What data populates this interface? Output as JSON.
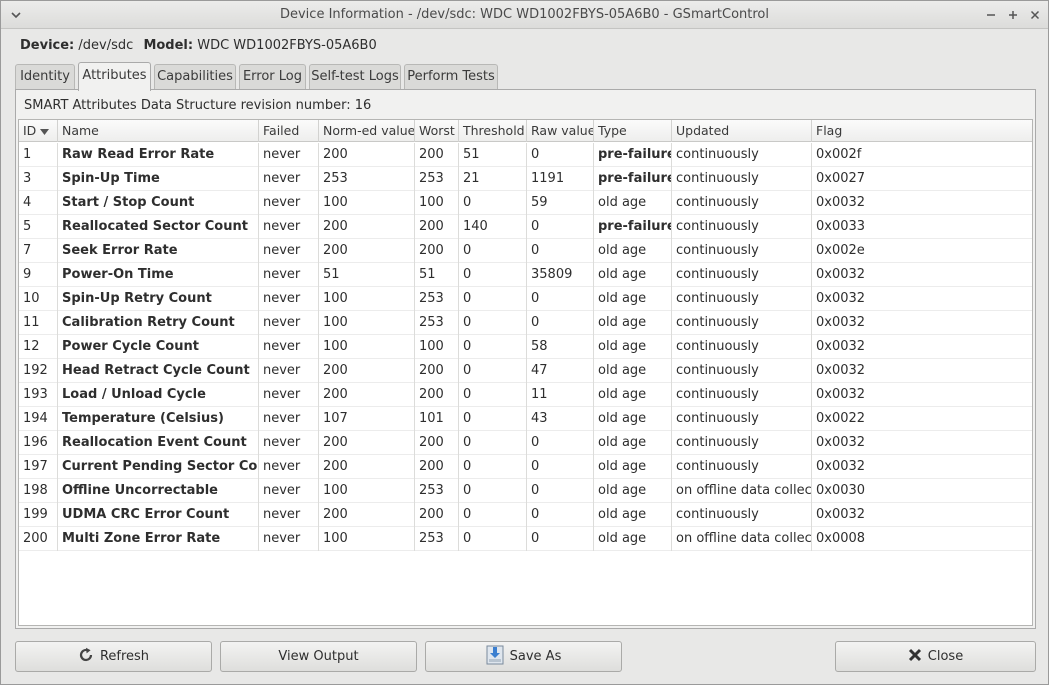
{
  "window": {
    "title": "Device Information - /dev/sdc: WDC WD1002FBYS-05A6B0 - GSmartControl"
  },
  "device": {
    "device_label": "Device:",
    "device_value": "/dev/sdc",
    "model_label": "Model:",
    "model_value": "WDC WD1002FBYS-05A6B0"
  },
  "tabs": [
    {
      "label": "Identity",
      "active": false
    },
    {
      "label": "Attributes",
      "active": true
    },
    {
      "label": "Capabilities",
      "active": false
    },
    {
      "label": "Error Log",
      "active": false
    },
    {
      "label": "Self-test Logs",
      "active": false
    },
    {
      "label": "Perform Tests",
      "active": false
    }
  ],
  "attributes": {
    "revision_text": "SMART Attributes Data Structure revision number: 16",
    "columns": [
      "ID",
      "Name",
      "Failed",
      "Norm-ed value",
      "Worst",
      "Threshold",
      "Raw value",
      "Type",
      "Updated",
      "Flag"
    ],
    "rows": [
      {
        "id": "1",
        "name": "Raw Read Error Rate",
        "failed": "never",
        "norm": "200",
        "worst": "200",
        "threshold": "51",
        "raw": "0",
        "type": "pre-failure",
        "updated": "continuously",
        "flag": "0x002f"
      },
      {
        "id": "3",
        "name": "Spin-Up Time",
        "failed": "never",
        "norm": "253",
        "worst": "253",
        "threshold": "21",
        "raw": "1191",
        "type": "pre-failure",
        "updated": "continuously",
        "flag": "0x0027"
      },
      {
        "id": "4",
        "name": "Start / Stop Count",
        "failed": "never",
        "norm": "100",
        "worst": "100",
        "threshold": "0",
        "raw": "59",
        "type": "old age",
        "updated": "continuously",
        "flag": "0x0032"
      },
      {
        "id": "5",
        "name": "Reallocated Sector Count",
        "failed": "never",
        "norm": "200",
        "worst": "200",
        "threshold": "140",
        "raw": "0",
        "type": "pre-failure",
        "updated": "continuously",
        "flag": "0x0033"
      },
      {
        "id": "7",
        "name": "Seek Error Rate",
        "failed": "never",
        "norm": "200",
        "worst": "200",
        "threshold": "0",
        "raw": "0",
        "type": "old age",
        "updated": "continuously",
        "flag": "0x002e"
      },
      {
        "id": "9",
        "name": "Power-On Time",
        "failed": "never",
        "norm": "51",
        "worst": "51",
        "threshold": "0",
        "raw": "35809",
        "type": "old age",
        "updated": "continuously",
        "flag": "0x0032"
      },
      {
        "id": "10",
        "name": "Spin-Up Retry Count",
        "failed": "never",
        "norm": "100",
        "worst": "253",
        "threshold": "0",
        "raw": "0",
        "type": "old age",
        "updated": "continuously",
        "flag": "0x0032"
      },
      {
        "id": "11",
        "name": "Calibration Retry Count",
        "failed": "never",
        "norm": "100",
        "worst": "253",
        "threshold": "0",
        "raw": "0",
        "type": "old age",
        "updated": "continuously",
        "flag": "0x0032"
      },
      {
        "id": "12",
        "name": "Power Cycle Count",
        "failed": "never",
        "norm": "100",
        "worst": "100",
        "threshold": "0",
        "raw": "58",
        "type": "old age",
        "updated": "continuously",
        "flag": "0x0032"
      },
      {
        "id": "192",
        "name": "Head Retract Cycle Count",
        "failed": "never",
        "norm": "200",
        "worst": "200",
        "threshold": "0",
        "raw": "47",
        "type": "old age",
        "updated": "continuously",
        "flag": "0x0032"
      },
      {
        "id": "193",
        "name": "Load / Unload Cycle",
        "failed": "never",
        "norm": "200",
        "worst": "200",
        "threshold": "0",
        "raw": "11",
        "type": "old age",
        "updated": "continuously",
        "flag": "0x0032"
      },
      {
        "id": "194",
        "name": "Temperature (Celsius)",
        "failed": "never",
        "norm": "107",
        "worst": "101",
        "threshold": "0",
        "raw": "43",
        "type": "old age",
        "updated": "continuously",
        "flag": "0x0022"
      },
      {
        "id": "196",
        "name": "Reallocation Event Count",
        "failed": "never",
        "norm": "200",
        "worst": "200",
        "threshold": "0",
        "raw": "0",
        "type": "old age",
        "updated": "continuously",
        "flag": "0x0032"
      },
      {
        "id": "197",
        "name": "Current Pending Sector Count",
        "failed": "never",
        "norm": "200",
        "worst": "200",
        "threshold": "0",
        "raw": "0",
        "type": "old age",
        "updated": "continuously",
        "flag": "0x0032"
      },
      {
        "id": "198",
        "name": "Offline Uncorrectable",
        "failed": "never",
        "norm": "100",
        "worst": "253",
        "threshold": "0",
        "raw": "0",
        "type": "old age",
        "updated": "on offline data collect.",
        "flag": "0x0030"
      },
      {
        "id": "199",
        "name": "UDMA CRC Error Count",
        "failed": "never",
        "norm": "200",
        "worst": "200",
        "threshold": "0",
        "raw": "0",
        "type": "old age",
        "updated": "continuously",
        "flag": "0x0032"
      },
      {
        "id": "200",
        "name": "Multi Zone Error Rate",
        "failed": "never",
        "norm": "100",
        "worst": "253",
        "threshold": "0",
        "raw": "0",
        "type": "old age",
        "updated": "on offline data collect.",
        "flag": "0x0008"
      }
    ]
  },
  "footer": {
    "refresh_label": "Refresh",
    "view_output_label": "View Output",
    "save_as_label": "Save As",
    "close_label": "Close"
  }
}
